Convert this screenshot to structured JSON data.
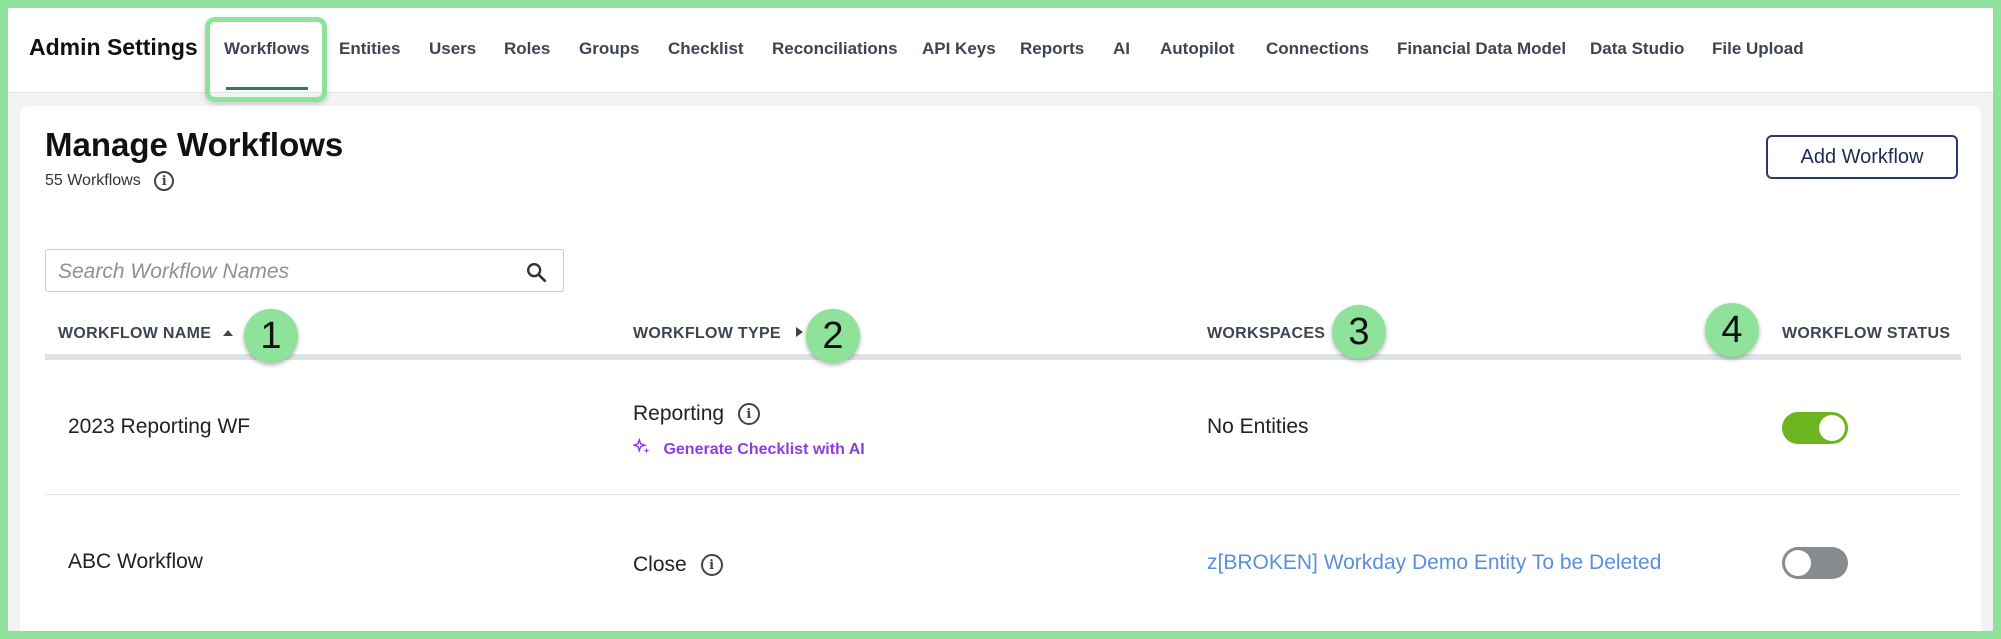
{
  "app": {
    "title": "Admin Settings"
  },
  "nav": {
    "tabs": [
      {
        "label": "Workflows"
      },
      {
        "label": "Entities"
      },
      {
        "label": "Users"
      },
      {
        "label": "Roles"
      },
      {
        "label": "Groups"
      },
      {
        "label": "Checklist"
      },
      {
        "label": "Reconciliations"
      },
      {
        "label": "API Keys"
      },
      {
        "label": "Reports"
      },
      {
        "label": "AI"
      },
      {
        "label": "Autopilot"
      },
      {
        "label": "Connections"
      },
      {
        "label": "Financial Data Model"
      },
      {
        "label": "Data Studio"
      },
      {
        "label": "File Upload"
      }
    ],
    "active_tab": "Workflows"
  },
  "page": {
    "title": "Manage Workflows",
    "count_label": "55 Workflows",
    "add_button": "Add Workflow"
  },
  "search": {
    "placeholder": "Search Workflow Names",
    "value": ""
  },
  "table": {
    "columns": [
      "WORKFLOW NAME",
      "WORKFLOW TYPE",
      "WORKSPACES",
      "WORKFLOW STATUS"
    ],
    "rows": [
      {
        "name": "2023 Reporting WF",
        "type": "Reporting",
        "action": "Generate Checklist with AI",
        "workspaces": "No Entities",
        "status_on": true
      },
      {
        "name": "ABC Workflow",
        "type": "Close",
        "workspaces": "z[BROKEN] Workday Demo Entity To be Deleted",
        "status_on": false
      }
    ]
  },
  "annotations": {
    "markers": [
      "1",
      "2",
      "3",
      "4"
    ]
  },
  "colors": {
    "annotation_green": "#8ee29a",
    "toggle_on": "#6db51f",
    "toggle_off": "#878b8f",
    "ai_link": "#8a3ee0",
    "workspace_link": "#5b8fd9",
    "button_border": "#2c3a6b"
  }
}
